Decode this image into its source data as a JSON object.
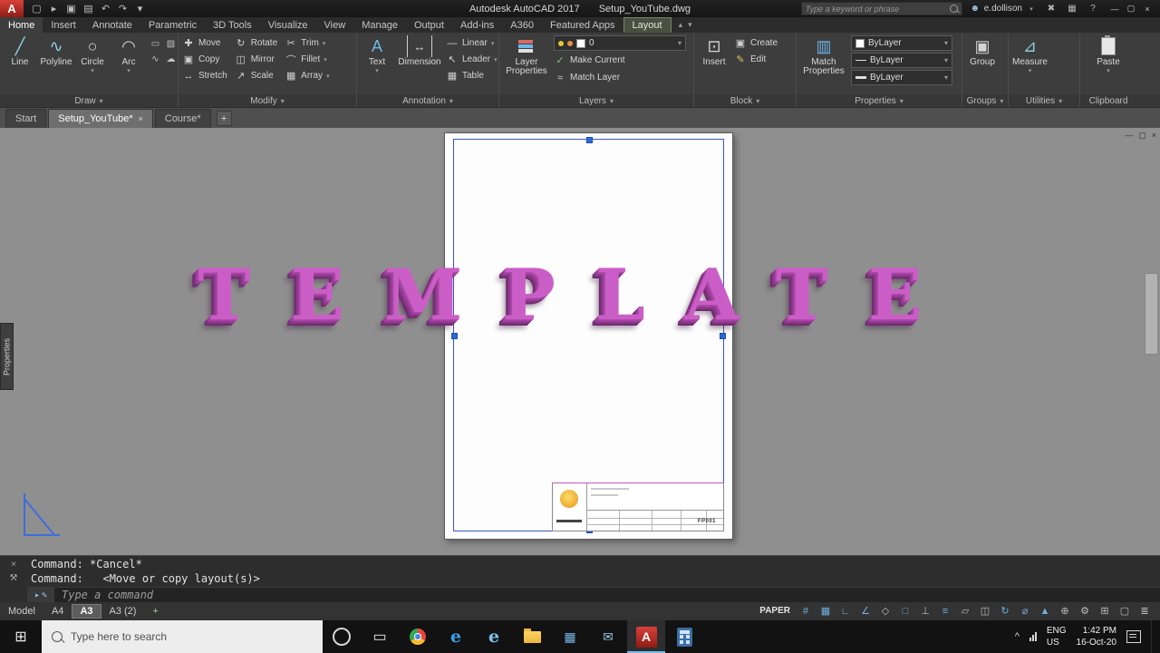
{
  "titlebar": {
    "logo_letter": "A",
    "app_title": "Autodesk AutoCAD 2017",
    "doc_title": "Setup_YouTube.dwg",
    "search_placeholder": "Type a keyword or phrase",
    "user": "e.dollison",
    "qat": [
      "▢",
      "▸",
      "▣",
      "▤",
      "↶",
      "↷",
      "▾"
    ]
  },
  "ribbon": {
    "tabs": [
      "Home",
      "Insert",
      "Annotate",
      "Parametric",
      "3D Tools",
      "Visualize",
      "View",
      "Manage",
      "Output",
      "Add-ins",
      "A360",
      "Featured Apps",
      "Layout"
    ],
    "draw": {
      "label": "Draw",
      "line": "Line",
      "polyline": "Polyline",
      "circle": "Circle",
      "arc": "Arc"
    },
    "modify": {
      "label": "Modify",
      "move": "Move",
      "rotate": "Rotate",
      "trim": "Trim",
      "copy": "Copy",
      "mirror": "Mirror",
      "fillet": "Fillet",
      "stretch": "Stretch",
      "scale": "Scale",
      "array": "Array"
    },
    "annotation": {
      "label": "Annotation",
      "text": "Text",
      "dimension": "Dimension",
      "linear": "Linear",
      "leader": "Leader",
      "table": "Table"
    },
    "layers": {
      "label": "Layers",
      "layer_properties": "Layer Properties",
      "current_layer": "0",
      "make_current": "Make Current",
      "match_layer": "Match Layer"
    },
    "block": {
      "label": "Block",
      "insert": "Insert",
      "create": "Create",
      "edit": "Edit"
    },
    "properties": {
      "label": "Properties",
      "match_properties": "Match Properties",
      "bylayer_color": "ByLayer",
      "bylayer_linetype": "ByLayer",
      "bylayer_lineweight": "ByLayer"
    },
    "groups": {
      "label": "Groups",
      "group": "Group"
    },
    "utilities": {
      "label": "Utilities",
      "measure": "Measure"
    },
    "clipboard": {
      "label": "Clipboard",
      "paste": "Paste"
    }
  },
  "filetabs": {
    "tabs": [
      "Start",
      "Setup_YouTube*",
      "Course*"
    ]
  },
  "canvas": {
    "template_text": "TEMPLATE",
    "properties_tab": "Properties",
    "titleblock_number": "FP001"
  },
  "command": {
    "line1": "Command: *Cancel*",
    "line2": "Command:   <Move or copy layout(s)>",
    "placeholder": "Type a command"
  },
  "statusbar": {
    "model": "Model",
    "a4": "A4",
    "a3": "A3",
    "a3_2": "A3 (2)",
    "paper": "PAPER",
    "icons": [
      "#",
      "▦",
      "∟",
      "∠",
      "◇",
      "□",
      "⊥",
      "≡",
      "▱",
      "◫",
      "↻",
      "⌀",
      "▲",
      "⊕",
      "⚙",
      "⊞",
      "▢",
      "≣"
    ]
  },
  "taskbar": {
    "search_placeholder": "Type here to search",
    "edge_letter": "e",
    "ie_letter": "e",
    "autocad_letter": "A",
    "lang": "ENG",
    "region": "US",
    "time": "1:42 PM",
    "date": "16-Oct-20"
  },
  "glyphs": {
    "caret_down": "▾",
    "caret_up": "▴",
    "close": "×",
    "minimize": "—",
    "restore": "▢",
    "plus": "+",
    "line": "╱",
    "polyline": "∿",
    "circle": "○",
    "arc": "◠",
    "rect": "▭",
    "hatch": "▨",
    "ellipse": "◯",
    "spline": "∿",
    "revcloud": "☁",
    "point": "⊙",
    "move": "✚",
    "rotate": "↻",
    "trim": "✂",
    "copy": "▣",
    "mirror": "◫",
    "fillet": "⌒",
    "stretch": "↔",
    "scale": "↗",
    "array": "▦",
    "text": "A",
    "dimension": "↔",
    "linear": "—",
    "leader": "↖",
    "table": "▦",
    "make_current": "✓",
    "match_layer": "≈",
    "insert": "⊡",
    "create": "▣",
    "edit": "✎",
    "match_props": "▥",
    "group": "▣",
    "measure": "⊿",
    "user": "☻",
    "help": "?",
    "a360": "✖",
    "apps": "▦",
    "mail": "✉",
    "start": "⊞",
    "taskview": "▭",
    "chevron_up": "^",
    "prompt": "▸",
    "pencil": "✎",
    "wrench": "⚒"
  },
  "colors": {
    "accent_magenta": "#cb5ec6",
    "paper_white": "#fdfdfd",
    "canvas_gray": "#8f8f8f"
  }
}
